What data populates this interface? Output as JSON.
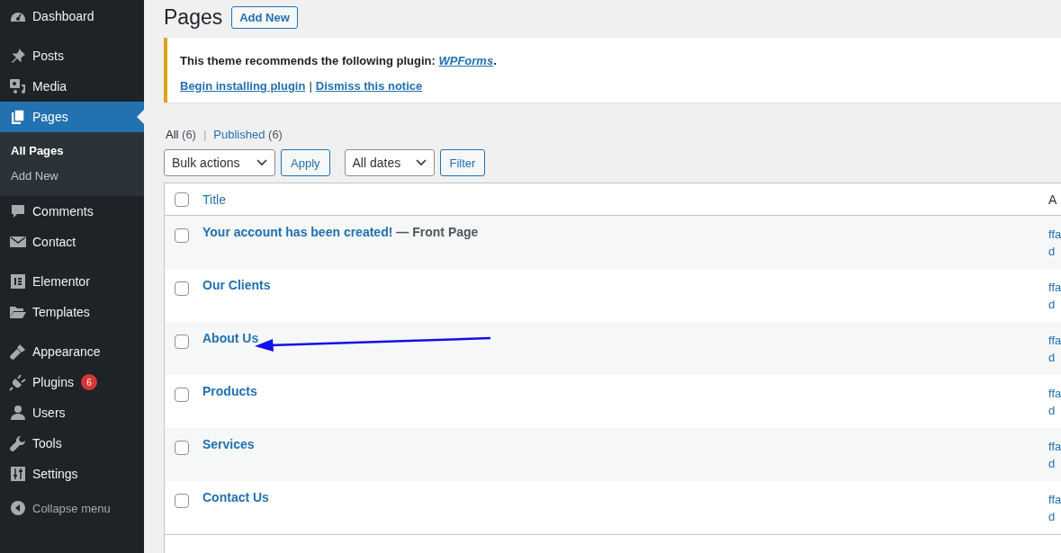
{
  "sidebar": {
    "groups": [
      [
        {
          "label": "Dashboard",
          "selected": false
        }
      ],
      [
        {
          "label": "Posts",
          "selected": false
        },
        {
          "label": "Media",
          "selected": false
        },
        {
          "label": "Pages",
          "selected": true,
          "children": [
            {
              "label": "All Pages",
              "selected": true
            },
            {
              "label": "Add New",
              "selected": false
            }
          ]
        },
        {
          "label": "Comments",
          "selected": false
        },
        {
          "label": "Contact",
          "selected": false
        }
      ],
      [
        {
          "label": "Elementor",
          "selected": false
        },
        {
          "label": "Templates",
          "selected": false
        }
      ],
      [
        {
          "label": "Appearance",
          "selected": false
        },
        {
          "label": "Plugins",
          "selected": false,
          "badge": "6"
        },
        {
          "label": "Users",
          "selected": false
        },
        {
          "label": "Tools",
          "selected": false
        },
        {
          "label": "Settings",
          "selected": false
        }
      ]
    ],
    "collapse": "Collapse menu"
  },
  "page_title": "Pages",
  "add_new": "Add New",
  "notice": {
    "text": "This theme recommends the following plugin: ",
    "plugin": "WPForms",
    "period": ".",
    "actions": [
      "Begin installing plugin",
      "Dismiss this notice"
    ],
    "separator": "|"
  },
  "views": [
    {
      "label": "All",
      "count": "(6)",
      "selected": true
    },
    {
      "label": "Published",
      "count": "(6)",
      "selected": false
    }
  ],
  "views_separator": "|",
  "bulk_select": "Bulk actions",
  "apply": "Apply",
  "date_select": "All dates",
  "filter": "Filter",
  "table": {
    "header_checked": false,
    "columns": [
      "Title",
      "A"
    ],
    "rows": [
      {
        "title": "Your account has been created!",
        "state": "— Front Page",
        "checked": false,
        "author": [
          "ffa",
          "d"
        ]
      },
      {
        "title": "Our Clients",
        "checked": false,
        "author": [
          "ffa",
          "d"
        ]
      },
      {
        "title": "About Us",
        "checked": false,
        "author": [
          "ffa",
          "d"
        ]
      },
      {
        "title": "Products",
        "checked": false,
        "author": [
          "ffa",
          "d"
        ]
      },
      {
        "title": "Services",
        "checked": false,
        "author": [
          "ffa",
          "d"
        ]
      },
      {
        "title": "Contact Us",
        "checked": false,
        "author": [
          "ffa",
          "d"
        ]
      }
    ]
  }
}
